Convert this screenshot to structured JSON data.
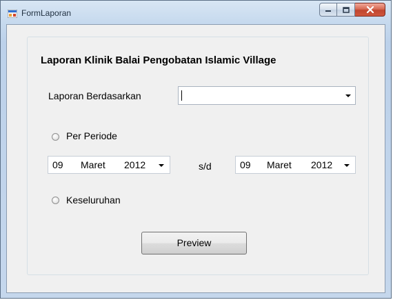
{
  "window": {
    "title": "FormLaporan"
  },
  "group": {
    "title": "Laporan Klinik Balai Pengobatan Islamic Village"
  },
  "report_basis": {
    "label": "Laporan Berdasarkan",
    "value": ""
  },
  "per_periode": {
    "label": "Per Periode",
    "selected": false
  },
  "date_from": {
    "day": "09",
    "month": "Maret",
    "year": "2012"
  },
  "separator": "s/d",
  "date_to": {
    "day": "09",
    "month": "Maret",
    "year": "2012"
  },
  "keseluruhan": {
    "label": "Keseluruhan",
    "selected": false
  },
  "preview_button": {
    "label": "Preview"
  }
}
